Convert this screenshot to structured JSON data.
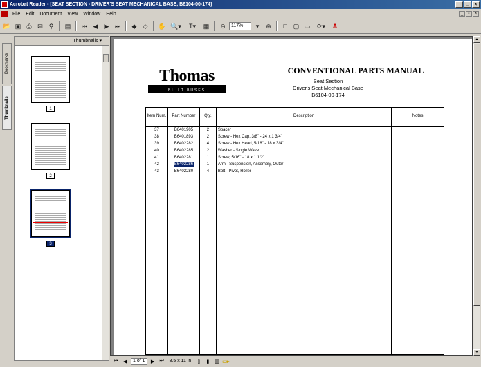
{
  "window": {
    "title": "Acrobat Reader - [SEAT SECTION - DRIVER'S SEAT MECHANICAL BASE, B6104-00-174]"
  },
  "menubar": {
    "items": [
      "File",
      "Edit",
      "Document",
      "View",
      "Window",
      "Help"
    ]
  },
  "toolbar": {
    "zoom_value": "117%"
  },
  "nav": {
    "tabs": [
      "Thumbnails",
      "Bookmarks"
    ],
    "panel_title": "Thumbnails ▾",
    "thumbnails": [
      {
        "label": "1"
      },
      {
        "label": "2"
      },
      {
        "label": "3"
      }
    ]
  },
  "document": {
    "logo_name": "Thomas",
    "logo_tag": "BUILT BUSES",
    "title": "CONVENTIONAL PARTS MANUAL",
    "subtitle1": "Seat Section",
    "subtitle2": "Driver's Seat Mechanical Base",
    "subtitle3": "B6104-00-174",
    "table": {
      "headers": {
        "item": "Item Num.",
        "part": "Part Number",
        "qty": "Qty.",
        "description": "Description",
        "notes": "Notes"
      },
      "rows": [
        {
          "item": "37",
          "part": "B6401905",
          "qty": "2",
          "description": "Spacer",
          "notes": ""
        },
        {
          "item": "38",
          "part": "B6401893",
          "qty": "2",
          "description": "Screw - Hex Cap, 3/8\" - 24 x 1 3/4\"",
          "notes": ""
        },
        {
          "item": "39",
          "part": "B6402282",
          "qty": "4",
          "description": "Screw - Hex Head, 5/16\" - 18 x 3/4\"",
          "notes": ""
        },
        {
          "item": "40",
          "part": "B6402285",
          "qty": "2",
          "description": "Washer - Single Wave",
          "notes": ""
        },
        {
          "item": "41",
          "part": "B6402281",
          "qty": "1",
          "description": "Screw, 5/16\" - 18 x 1 1/2\"",
          "notes": ""
        },
        {
          "item": "42",
          "part": "B6402286",
          "qty": "1",
          "description": "Arm - Suspension, Assembly, Outer",
          "notes": ""
        },
        {
          "item": "43",
          "part": "B6402280",
          "qty": "4",
          "description": "Bolt - Pivot, Roller",
          "notes": ""
        }
      ]
    }
  },
  "statusbar": {
    "page_field": "1 of 1",
    "page_size": "8.5 x 11 in"
  }
}
